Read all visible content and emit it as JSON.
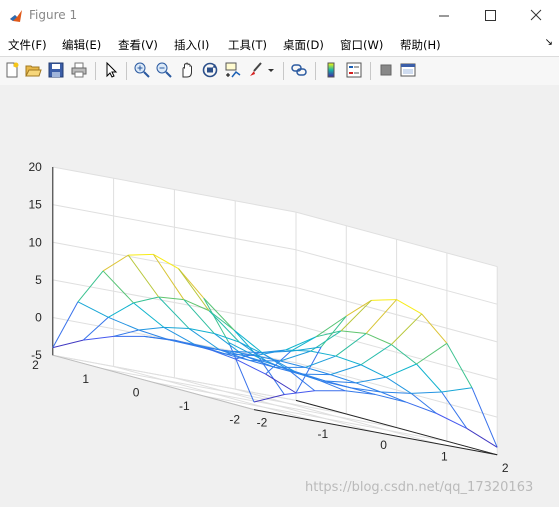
{
  "window": {
    "title": "Figure 1",
    "minimize_glyph": "—",
    "maximize_glyph": "☐",
    "close_glyph": "✕"
  },
  "menubar": {
    "items": [
      {
        "label": "文件(F)"
      },
      {
        "label": "编辑(E)"
      },
      {
        "label": "查看(V)"
      },
      {
        "label": "插入(I)"
      },
      {
        "label": "工具(T)"
      },
      {
        "label": "桌面(D)"
      },
      {
        "label": "窗口(W)"
      },
      {
        "label": "帮助(H)"
      }
    ],
    "overflow_glyph": "↘"
  },
  "toolbar": {
    "icons": [
      "new-figure-icon",
      "open-file-icon",
      "save-icon",
      "print-icon",
      "pointer-icon",
      "zoom-in-icon",
      "zoom-out-icon",
      "pan-icon",
      "rotate-3d-icon",
      "data-cursor-icon",
      "brush-icon",
      "brush-dropdown-icon",
      "link-plot-icon",
      "colorbar-icon",
      "legend-icon",
      "hide-plot-tools-icon",
      "show-plot-tools-icon"
    ]
  },
  "chart_data": {
    "type": "surface-mesh",
    "title": "",
    "xlabel": "",
    "ylabel": "",
    "zlabel": "",
    "x": [
      -2,
      -1.5,
      -1,
      -0.5,
      0,
      0.5,
      1,
      1.5,
      2
    ],
    "y": [
      -2,
      -1.5,
      -1,
      -0.5,
      0,
      0.5,
      1,
      1.5,
      2
    ],
    "z_function": "x^2*(3 - y^2)",
    "xlim": [
      -2,
      2
    ],
    "ylim": [
      -2,
      2
    ],
    "zlim": [
      -5,
      20
    ],
    "xticks": [
      "-2",
      "-1",
      "0",
      "1",
      "2"
    ],
    "yticks": [
      "-2",
      "-1",
      "0",
      "1",
      "2"
    ],
    "zticks": [
      "-5",
      "0",
      "5",
      "10",
      "15",
      "20"
    ],
    "colormap": "parula",
    "grid": true
  },
  "watermark": "https://blog.csdn.net/qq_17320163"
}
